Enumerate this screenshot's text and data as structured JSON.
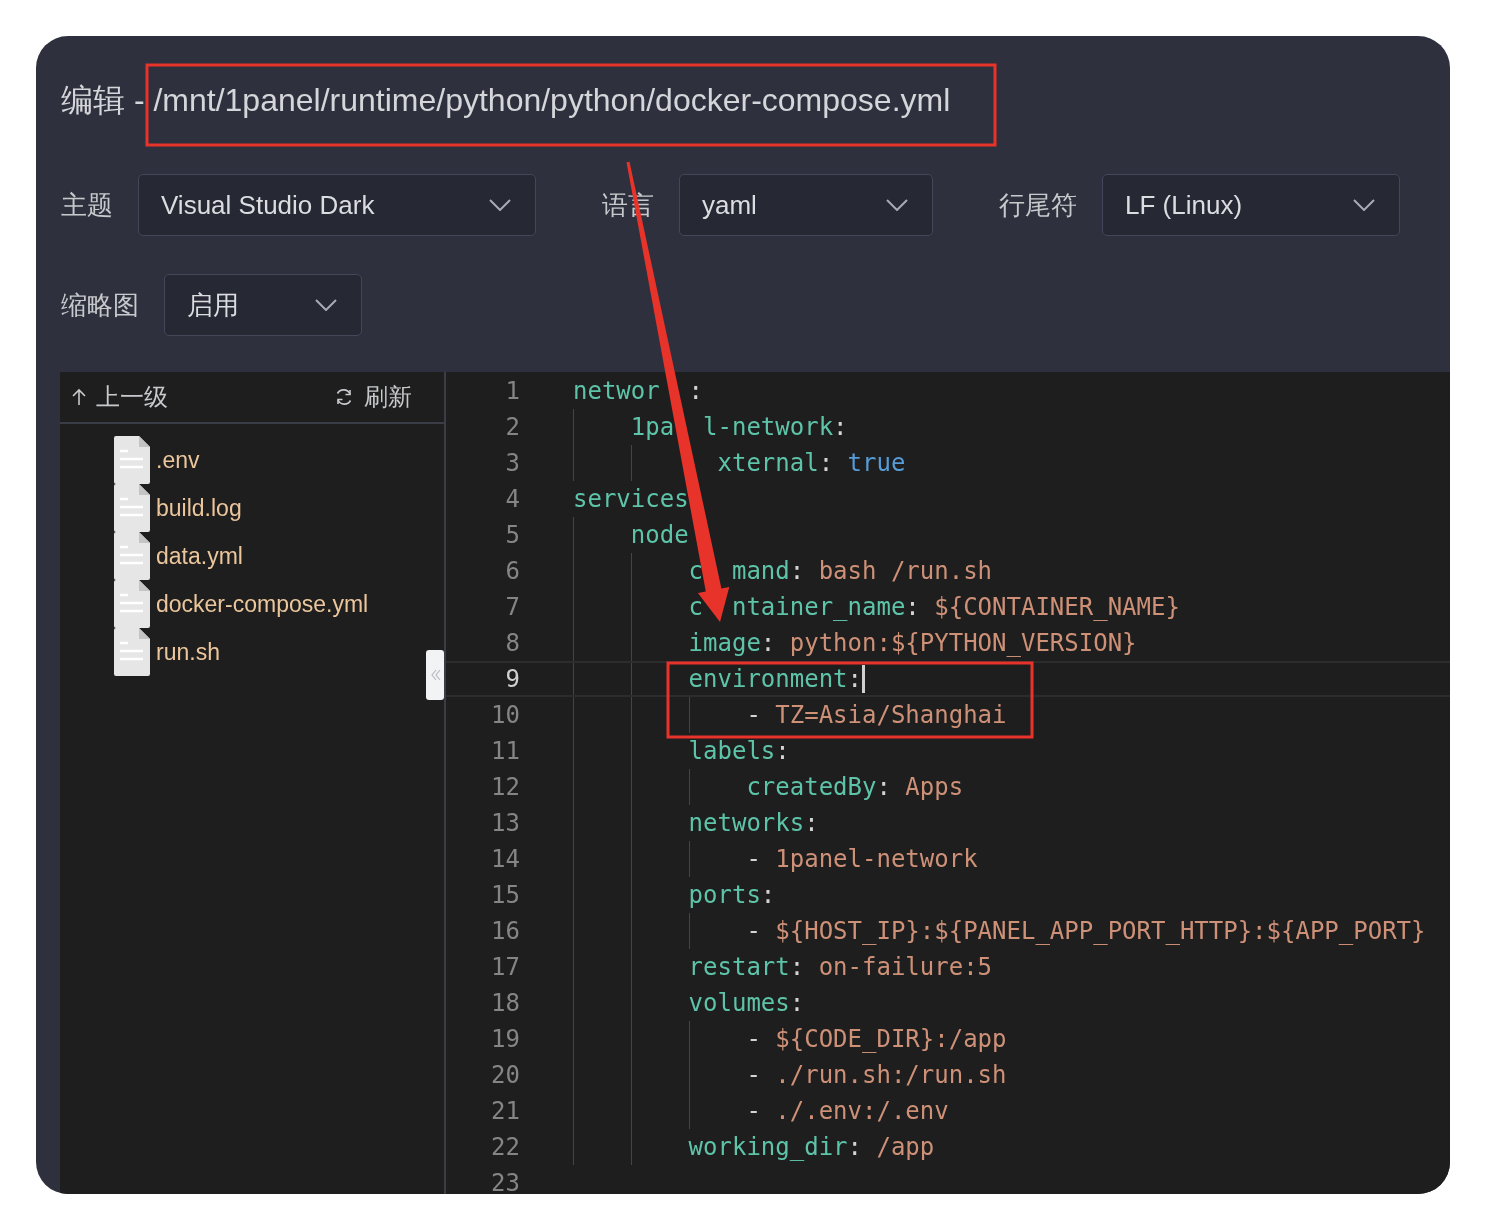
{
  "dialog": {
    "title": "编辑 - /mnt/1panel/runtime/python/python/docker-compose.yml",
    "settings": [
      {
        "label": "主题",
        "value": "Visual Studio Dark"
      },
      {
        "label": "语言",
        "value": "yaml"
      },
      {
        "label": "行尾符",
        "value": "LF (Linux)"
      },
      {
        "label": "缩略图",
        "value": "启用"
      }
    ],
    "file_browser": {
      "up_label": "上一级",
      "refresh_label": "刷新",
      "files": [
        {
          "name": ".env"
        },
        {
          "name": "build.log"
        },
        {
          "name": "data.yml"
        },
        {
          "name": "docker-compose.yml"
        },
        {
          "name": "run.sh"
        }
      ]
    },
    "editor": {
      "lines": [
        {
          "number": "1",
          "current": false,
          "tokens": [
            {
              "text": "networ",
              "kind": "key"
            },
            {
              "text": ":",
              "kind": "punct",
              "covered_before": true
            }
          ],
          "children": [
            {
              "number": "2",
              "current": false,
              "tokens": [
                {
                  "text": "1pa",
                  "kind": "key"
                },
                {
                  "text": "l-network",
                  "kind": "key",
                  "covered_before": true
                },
                {
                  "text": ":",
                  "kind": "punct"
                }
              ],
              "children": [
                {
                  "number": "3",
                  "current": false,
                  "tokens": [
                    {
                      "text": "xternal",
                      "kind": "key",
                      "covered_before": true
                    },
                    {
                      "text": ": ",
                      "kind": "punct"
                    },
                    {
                      "text": "true",
                      "kind": "bool"
                    }
                  ]
                }
              ]
            }
          ]
        },
        {
          "number": "4",
          "current": false,
          "tokens": [
            {
              "text": "services",
              "kind": "key"
            }
          ],
          "children": [
            {
              "number": "5",
              "current": false,
              "tokens": [
                {
                  "text": "node",
                  "kind": "key"
                }
              ],
              "children": [
                {
                  "number": "6",
                  "current": false,
                  "tokens": [
                    {
                      "text": "c",
                      "kind": "key"
                    },
                    {
                      "text": "mand",
                      "kind": "key",
                      "covered_before": true
                    },
                    {
                      "text": ": ",
                      "kind": "punct"
                    },
                    {
                      "text": "bash /run.sh",
                      "kind": "string"
                    }
                  ]
                },
                {
                  "number": "7",
                  "current": false,
                  "tokens": [
                    {
                      "text": "c",
                      "kind": "key"
                    },
                    {
                      "text": "ntainer_name",
                      "kind": "key",
                      "covered_before": true
                    },
                    {
                      "text": ": ",
                      "kind": "punct"
                    },
                    {
                      "text": "${CONTAINER_NAME}",
                      "kind": "string"
                    }
                  ]
                },
                {
                  "number": "8",
                  "current": false,
                  "tokens": [
                    {
                      "text": "image",
                      "kind": "key"
                    },
                    {
                      "text": ": ",
                      "kind": "punct"
                    },
                    {
                      "text": "python:${PYTHON_VERSION}",
                      "kind": "string"
                    }
                  ]
                },
                {
                  "number": "9",
                  "current": true,
                  "tokens": [
                    {
                      "text": "environment",
                      "kind": "key"
                    },
                    {
                      "text": ":",
                      "kind": "punct"
                    }
                  ],
                  "children": [
                    {
                      "number": "10",
                      "current": false,
                      "tokens": [
                        {
                          "text": "- ",
                          "kind": "punct"
                        },
                        {
                          "text": "TZ=Asia/Shanghai",
                          "kind": "string"
                        }
                      ]
                    }
                  ]
                },
                {
                  "number": "11",
                  "current": false,
                  "tokens": [
                    {
                      "text": "labels",
                      "kind": "key"
                    },
                    {
                      "text": ":",
                      "kind": "punct"
                    }
                  ],
                  "children": [
                    {
                      "number": "12",
                      "current": false,
                      "tokens": [
                        {
                          "text": "createdBy",
                          "kind": "key"
                        },
                        {
                          "text": ": ",
                          "kind": "punct"
                        },
                        {
                          "text": "Apps",
                          "kind": "string"
                        }
                      ]
                    }
                  ]
                },
                {
                  "number": "13",
                  "current": false,
                  "tokens": [
                    {
                      "text": "networks",
                      "kind": "key"
                    },
                    {
                      "text": ":",
                      "kind": "punct"
                    }
                  ],
                  "children": [
                    {
                      "number": "14",
                      "current": false,
                      "tokens": [
                        {
                          "text": "- ",
                          "kind": "punct"
                        },
                        {
                          "text": "1panel-network",
                          "kind": "string"
                        }
                      ]
                    }
                  ]
                },
                {
                  "number": "15",
                  "current": false,
                  "tokens": [
                    {
                      "text": "ports",
                      "kind": "key"
                    },
                    {
                      "text": ":",
                      "kind": "punct"
                    }
                  ],
                  "children": [
                    {
                      "number": "16",
                      "current": false,
                      "tokens": [
                        {
                          "text": "- ",
                          "kind": "punct"
                        },
                        {
                          "text": "${HOST_IP}:${PANEL_APP_PORT_HTTP}:${APP_PORT}",
                          "kind": "string"
                        }
                      ]
                    }
                  ]
                },
                {
                  "number": "17",
                  "current": false,
                  "tokens": [
                    {
                      "text": "restart",
                      "kind": "key"
                    },
                    {
                      "text": ": ",
                      "kind": "punct"
                    },
                    {
                      "text": "on-failure:5",
                      "kind": "string"
                    }
                  ]
                },
                {
                  "number": "18",
                  "current": false,
                  "tokens": [
                    {
                      "text": "volumes",
                      "kind": "key"
                    },
                    {
                      "text": ":",
                      "kind": "punct"
                    }
                  ],
                  "children": [
                    {
                      "number": "19",
                      "current": false,
                      "tokens": [
                        {
                          "text": "- ",
                          "kind": "punct"
                        },
                        {
                          "text": "${CODE_DIR}:/app",
                          "kind": "string"
                        }
                      ]
                    },
                    {
                      "number": "20",
                      "current": false,
                      "tokens": [
                        {
                          "text": "- ",
                          "kind": "punct"
                        },
                        {
                          "text": "./run.sh:/run.sh",
                          "kind": "string"
                        }
                      ]
                    },
                    {
                      "number": "21",
                      "current": false,
                      "tokens": [
                        {
                          "text": "- ",
                          "kind": "punct"
                        },
                        {
                          "text": "./.env:/.env",
                          "kind": "string"
                        }
                      ]
                    }
                  ]
                },
                {
                  "number": "22",
                  "current": false,
                  "tokens": [
                    {
                      "text": "working_dir",
                      "kind": "key"
                    },
                    {
                      "text": ": ",
                      "kind": "punct"
                    },
                    {
                      "text": "/app",
                      "kind": "string"
                    }
                  ]
                }
              ]
            }
          ]
        },
        {
          "number": "23",
          "current": false
        }
      ]
    }
  }
}
